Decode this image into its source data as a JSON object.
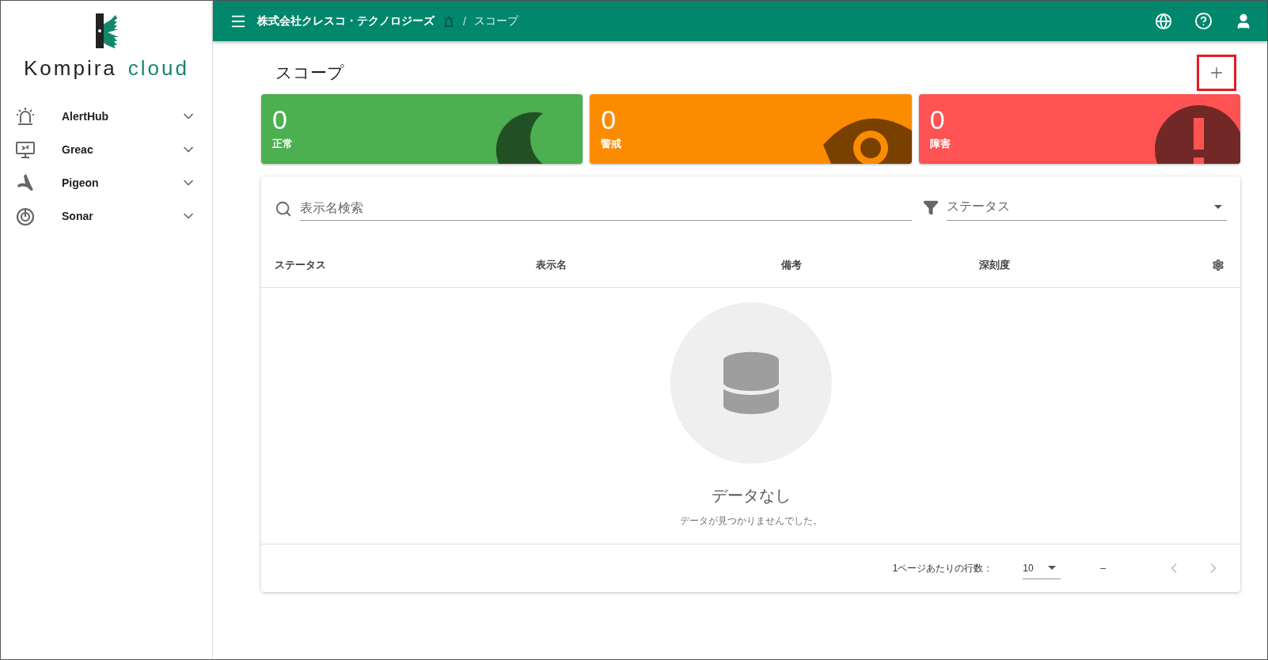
{
  "logo": {
    "word_1": "Kompira",
    "word_2": "cloud"
  },
  "sidebar": {
    "items": [
      {
        "label": "AlertHub",
        "kind": "siren",
        "expanded": false
      },
      {
        "label": "Greac",
        "kind": "monitor",
        "expanded": false
      },
      {
        "label": "Pigeon",
        "kind": "wing",
        "expanded": false
      },
      {
        "label": "Sonar",
        "kind": "sonar",
        "expanded": false
      }
    ]
  },
  "topbar": {
    "separator": "/",
    "breadcrumb": [
      {
        "label": "株式会社クレスコ・テクノロジーズ"
      },
      {
        "label": "スコープ"
      }
    ]
  },
  "page": {
    "title": "スコープ"
  },
  "status_cards": [
    {
      "kind": "normal",
      "count": "0",
      "label": "正常"
    },
    {
      "kind": "warning",
      "count": "0",
      "label": "警戒"
    },
    {
      "kind": "error",
      "count": "0",
      "label": "障害"
    }
  ],
  "filters": {
    "search": {
      "placeholder": "表示名検索"
    },
    "status": {
      "placeholder": "ステータス"
    }
  },
  "table": {
    "columns": [
      "ステータス",
      "表示名",
      "備考",
      "深刻度"
    ],
    "empty": {
      "title": "データなし",
      "message": "データが見つかりませんでした。"
    },
    "pagination": {
      "rows_label": "1ページあたりの行数：",
      "rows_per_page": "10",
      "range": "–"
    }
  }
}
